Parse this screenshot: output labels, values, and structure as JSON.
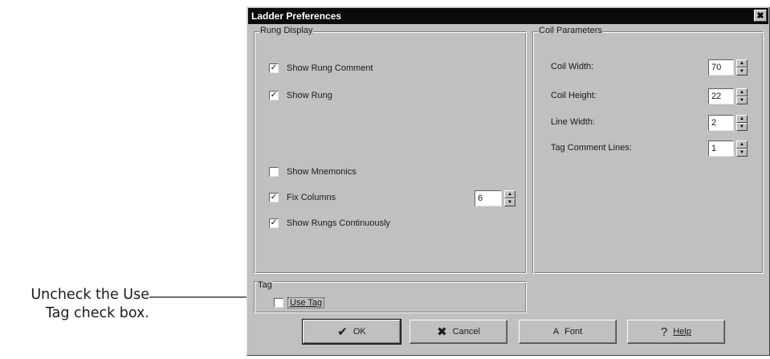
{
  "callout": {
    "line1": "Uncheck the Use",
    "line2": "Tag check box."
  },
  "dialog": {
    "title": "Ladder Preferences",
    "close_glyph": "×"
  },
  "rung_display": {
    "label": "Rung Display",
    "show_rung_comment": {
      "label": "Show Rung Comment",
      "checked": true
    },
    "show_rung": {
      "label": "Show Rung",
      "checked": true
    },
    "show_mnemonics": {
      "label": "Show Mnemonics",
      "checked": false
    },
    "fix_columns": {
      "label": "Fix Columns",
      "checked": true,
      "value": "6"
    },
    "show_rungs_continuously": {
      "label": "Show Rungs Continuously",
      "checked": true
    }
  },
  "coil_parameters": {
    "label": "Coil Parameters",
    "coil_width": {
      "label": "Coil Width:",
      "value": "70"
    },
    "coil_height": {
      "label": "Coil Height:",
      "value": "22"
    },
    "line_width": {
      "label": "Line Width:",
      "value": "2"
    },
    "tag_comment_lines": {
      "label": "Tag Comment Lines:",
      "value": "1"
    }
  },
  "tag": {
    "label": "Tag",
    "use_tag": {
      "label": "Use Tag",
      "checked": false
    }
  },
  "buttons": {
    "ok": {
      "label": "OK",
      "icon": "checkmark-icon"
    },
    "cancel": {
      "label": "Cancel",
      "icon": "x-icon"
    },
    "font": {
      "label": "Font",
      "icon": "font-icon"
    },
    "help": {
      "label": "Help",
      "icon": "question-icon"
    }
  },
  "glyphs": {
    "check": "✓",
    "spin_up": "▲",
    "spin_down": "▼",
    "ok_icon": "✔",
    "cancel_icon": "✖",
    "font_icon": "A",
    "help_icon": "?"
  }
}
